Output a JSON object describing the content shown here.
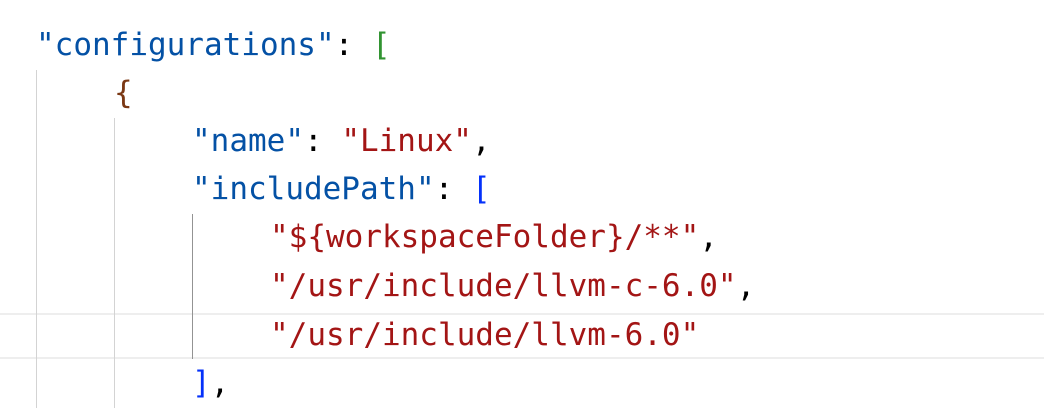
{
  "editor": {
    "language": "json",
    "colors": {
      "key": "#0451a5",
      "string": "#a31515",
      "punctuation": "#000000",
      "bracket_level1": "#319331",
      "bracket_level2": "#7b3814",
      "bracket_level3": "#0431fa",
      "indent_guide": "#d3d3d3",
      "active_indent_guide": "#939393",
      "current_line_border": "#eeeeee"
    },
    "lines": [
      {
        "key": "\"configurations\"",
        "colon": ": ",
        "bracket": "["
      },
      {
        "bracket": "{"
      },
      {
        "key": "\"name\"",
        "colon": ": ",
        "value": "\"Linux\"",
        "comma": ","
      },
      {
        "key": "\"includePath\"",
        "colon": ": ",
        "bracket": "["
      },
      {
        "value": "\"${workspaceFolder}/**\"",
        "comma": ","
      },
      {
        "value": "\"/usr/include/llvm-c-6.0\"",
        "comma": ","
      },
      {
        "value": "\"/usr/include/llvm-6.0\""
      },
      {
        "bracket": "]",
        "comma": ","
      }
    ]
  }
}
